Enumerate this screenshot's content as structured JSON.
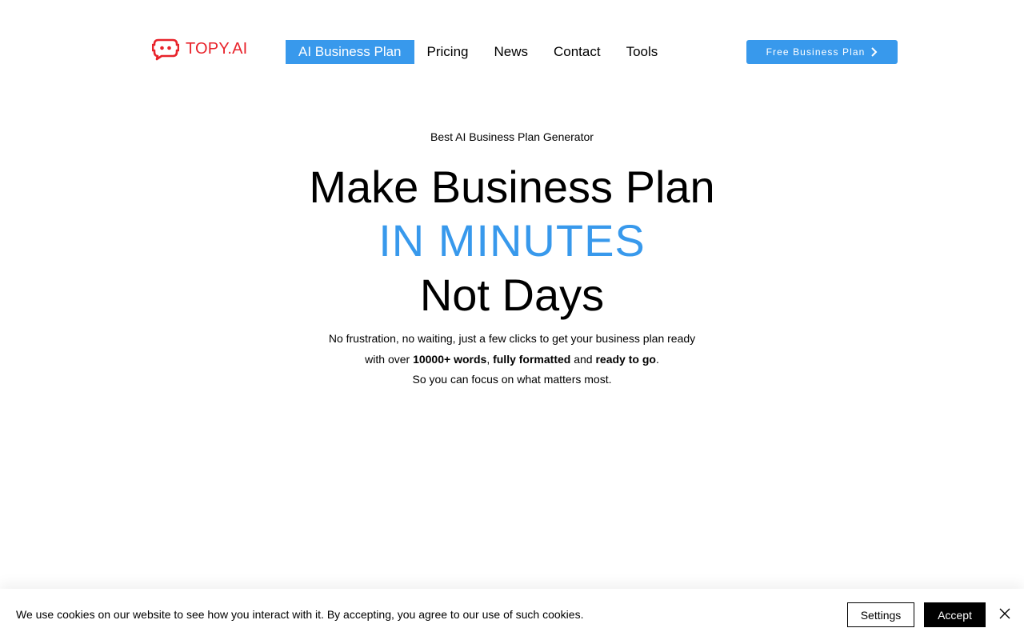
{
  "header": {
    "logo_text": "TOPY.AI",
    "logo_icon": "robot-speech-bubble-icon",
    "nav": [
      {
        "label": "AI Business Plan",
        "active": true
      },
      {
        "label": "Pricing",
        "active": false
      },
      {
        "label": "News",
        "active": false
      },
      {
        "label": "Contact",
        "active": false
      },
      {
        "label": "Tools",
        "active": false
      }
    ],
    "cta_label": "Free Business Plan",
    "cta_icon": "chevron-right-icon"
  },
  "hero": {
    "eyebrow": "Best AI Business Plan Generator",
    "title_line1": "Make Business Plan",
    "title_line2": "IN MINUTES",
    "title_line3": "Not Days",
    "desc_line1": "No frustration, no waiting, just a few clicks to get your business plan ready",
    "desc_line2_pre": "with over ",
    "desc_words": "10000+ words",
    "desc_sep": ", ",
    "desc_formatted": "fully formatted",
    "desc_and": " and ",
    "desc_ready": "ready to go",
    "desc_end": ".",
    "desc_line3": "So you can focus on what matters most."
  },
  "cookie": {
    "text": "We use cookies on our website to see how you interact with it. By accepting, you agree to our use of such cookies.",
    "settings_label": "Settings",
    "accept_label": "Accept",
    "close_icon": "close-icon"
  },
  "colors": {
    "brand_red": "#e8232b",
    "accent_blue": "#3899ec"
  }
}
